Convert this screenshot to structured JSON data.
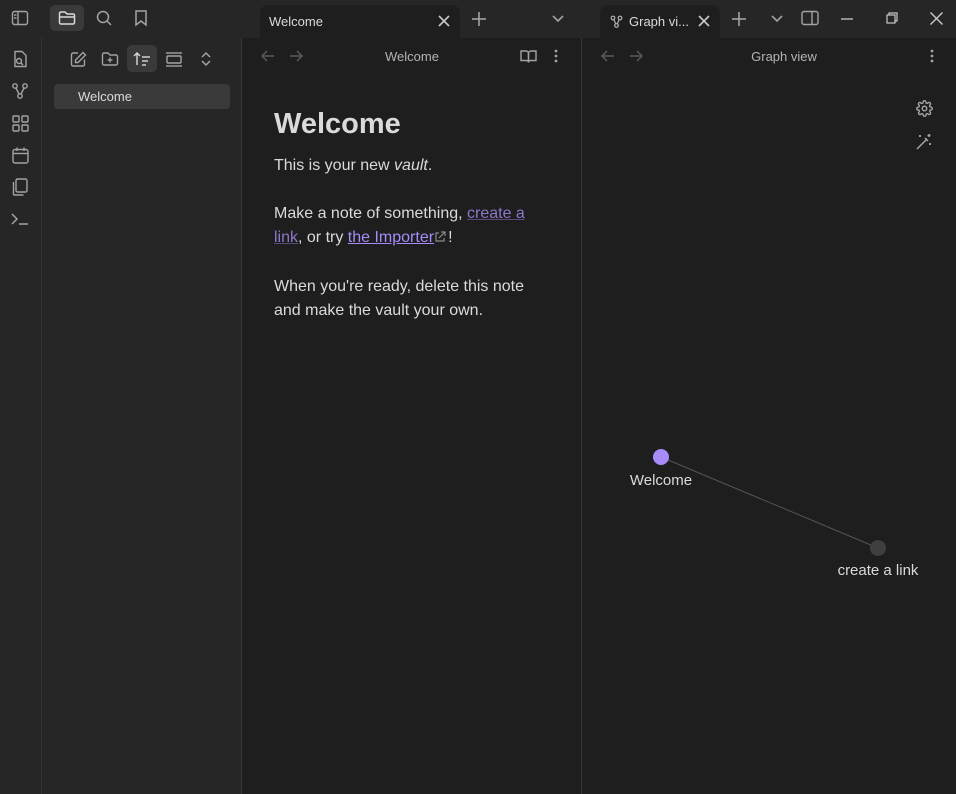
{
  "tabs": {
    "left": {
      "label": "Welcome"
    },
    "right": {
      "label": "Graph vi..."
    }
  },
  "sidebar": {
    "files": [
      {
        "label": "Welcome"
      }
    ]
  },
  "editor": {
    "view_title": "Welcome",
    "heading": "Welcome",
    "p1_before": "This is your new ",
    "p1_em": "vault",
    "p1_after": ".",
    "p2_before": "Make a note of something, ",
    "p2_link1": "create a link",
    "p2_mid": ", or try ",
    "p2_link2": "the Importer",
    "p2_after": "!",
    "p3": "When you're ready, delete this note and make the vault your own."
  },
  "graph": {
    "view_title": "Graph view",
    "nodes": [
      {
        "label": "Welcome",
        "color": "#a88bfa"
      },
      {
        "label": "create a link",
        "color": "#3f3f3f"
      }
    ]
  },
  "colors": {
    "accent": "#a88bfa",
    "link": "#8e76c9",
    "background": "#1e1e1e",
    "chrome": "#262626"
  }
}
